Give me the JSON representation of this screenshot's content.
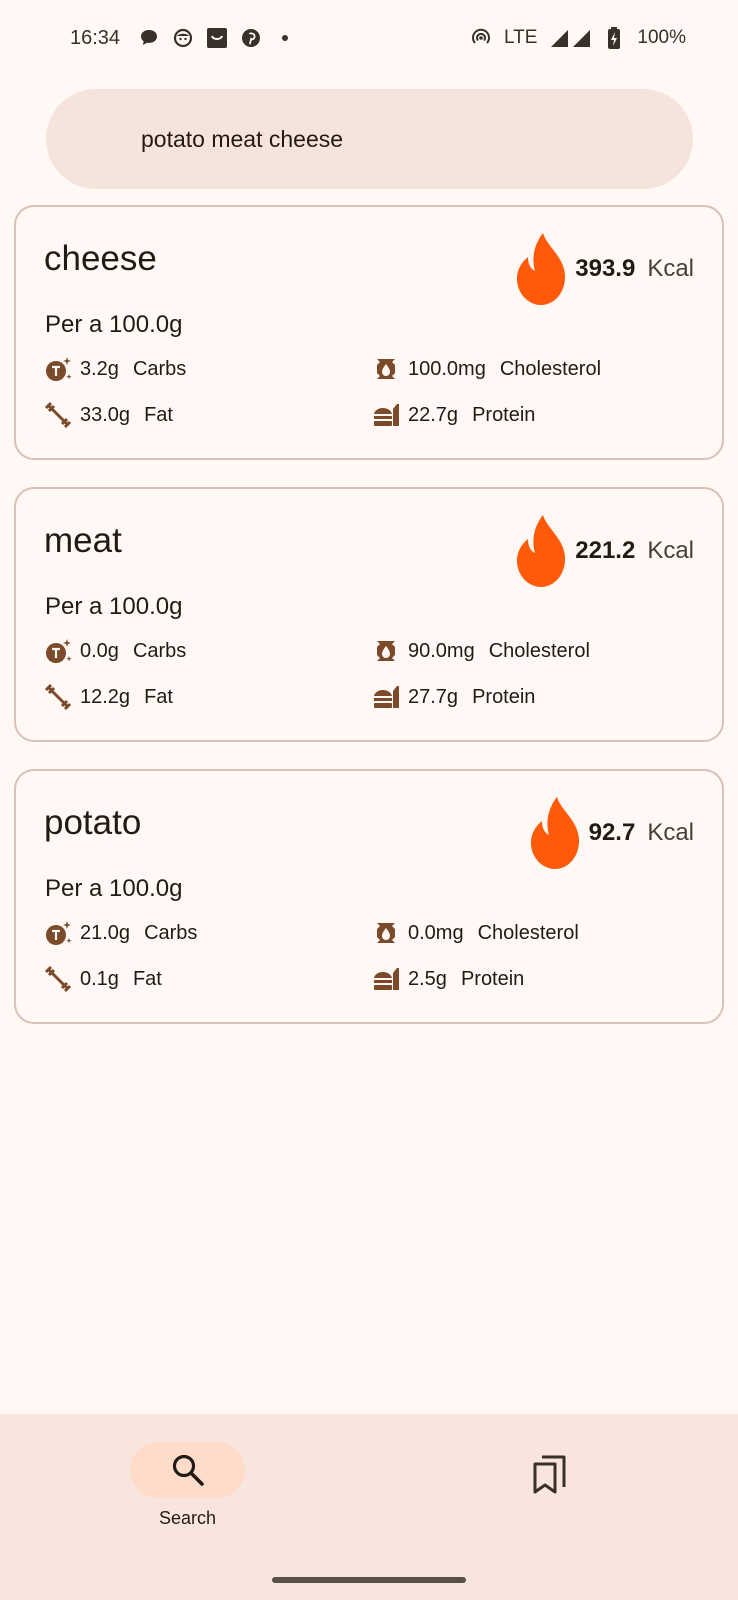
{
  "status_bar": {
    "time": "16:34",
    "network": "LTE",
    "battery": "100%",
    "notification_icons": [
      "chat-bubble-icon",
      "face-icon",
      "inbox-icon",
      "pinterest-icon",
      "dot-icon"
    ],
    "system_icons": [
      "hotspot-icon",
      "signal-icon",
      "signal-icon",
      "battery-charging-icon"
    ]
  },
  "search": {
    "query": "potato meat cheese"
  },
  "results": [
    {
      "name": "cheese",
      "kcal": "393.9",
      "kcal_unit": "Kcal",
      "per": "Per a 100.0g",
      "carbs_value": "3.2g",
      "carbs_label": "Carbs",
      "fat_value": "33.0g",
      "fat_label": "Fat",
      "cholesterol_value": "100.0mg",
      "cholesterol_label": "Cholesterol",
      "protein_value": "22.7g",
      "protein_label": "Protein"
    },
    {
      "name": "meat",
      "kcal": "221.2",
      "kcal_unit": "Kcal",
      "per": "Per a 100.0g",
      "carbs_value": "0.0g",
      "carbs_label": "Carbs",
      "fat_value": "12.2g",
      "fat_label": "Fat",
      "cholesterol_value": "90.0mg",
      "cholesterol_label": "Cholesterol",
      "protein_value": "27.7g",
      "protein_label": "Protein"
    },
    {
      "name": "potato",
      "kcal": "92.7",
      "kcal_unit": "Kcal",
      "per": "Per a 100.0g",
      "carbs_value": "21.0g",
      "carbs_label": "Carbs",
      "fat_value": "0.1g",
      "fat_label": "Fat",
      "cholesterol_value": "0.0mg",
      "cholesterol_label": "Cholesterol",
      "protein_value": "2.5g",
      "protein_label": "Protein"
    }
  ],
  "bottom_nav": {
    "search_label": "Search",
    "search_icon": "search-icon",
    "saved_icon": "bookmarks-icon"
  },
  "colors": {
    "background": "#fff8f5",
    "flame": "#ff5a0a",
    "icon_brown": "#7a4a2a",
    "search_bar": "#f5e4db",
    "nav_pill": "#ffdbc9",
    "card_border": "#d8c2b8"
  }
}
